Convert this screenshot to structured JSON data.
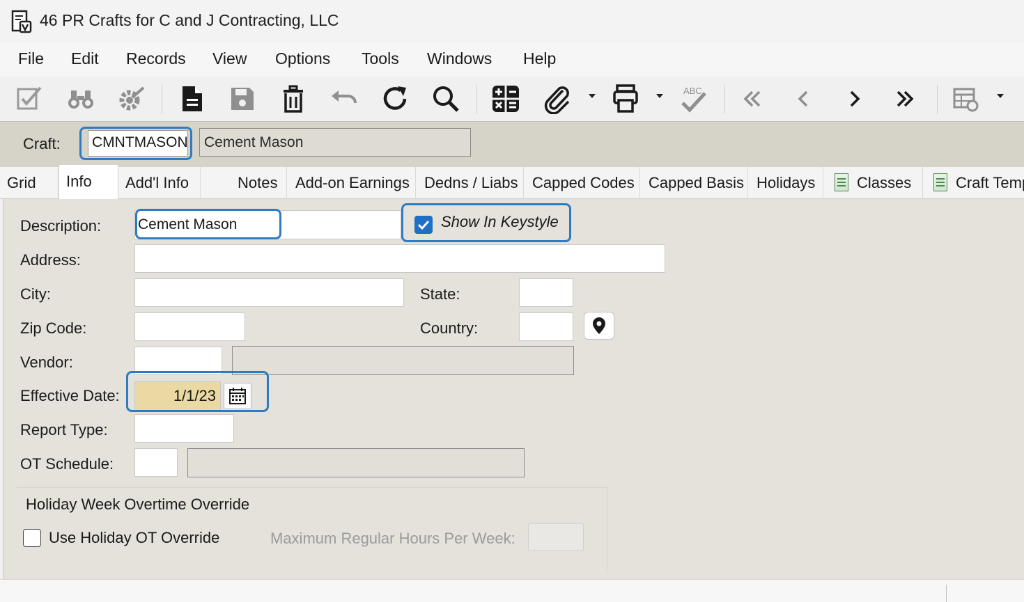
{
  "window": {
    "title": "46 PR Crafts for C and J Contracting, LLC"
  },
  "menu": {
    "file": "File",
    "edit": "Edit",
    "records": "Records",
    "view": "View",
    "options": "Options",
    "tools": "Tools",
    "windows": "Windows",
    "help": "Help"
  },
  "toolbar": {
    "icons": [
      "edit-icon",
      "binoculars-icon",
      "settings-gear-icon",
      "new-record-icon",
      "save-icon",
      "delete-icon",
      "undo-icon",
      "refresh-icon",
      "search-icon",
      "calculator-icon",
      "attachment-icon",
      "print-icon",
      "spellcheck-icon",
      "first-record-icon",
      "previous-record-icon",
      "next-record-icon",
      "last-record-icon",
      "grid-settings-icon"
    ],
    "spellcheck_text": "ABC"
  },
  "craft": {
    "label": "Craft:",
    "code": "CMNTMASON",
    "description": "Cement Mason"
  },
  "tabs": {
    "grid": "Grid",
    "info": "Info",
    "addl_info": "Add'l Info",
    "notes": "Notes",
    "addon_earnings": "Add-on Earnings",
    "dedns_liabs": "Dedns / Liabs",
    "capped_codes": "Capped Codes",
    "capped_basis": "Capped Basis",
    "holidays": "Holidays",
    "classes": "Classes",
    "craft_template": "Craft Template",
    "active": "Info"
  },
  "form": {
    "description_label": "Description:",
    "description_value": "Cement Mason",
    "show_in_keystyle_label": "Show In Keystyle",
    "show_in_keystyle_checked": true,
    "address_label": "Address:",
    "address_value": "",
    "city_label": "City:",
    "city_value": "",
    "state_label": "State:",
    "state_value": "",
    "zip_label": "Zip Code:",
    "zip_value": "",
    "country_label": "Country:",
    "country_value": "",
    "vendor_label": "Vendor:",
    "vendor_value": "",
    "vendor_name": "",
    "effective_date_label": "Effective Date:",
    "effective_date_value": "1/1/23",
    "report_type_label": "Report Type:",
    "report_type_value": "",
    "ot_schedule_label": "OT Schedule:",
    "ot_schedule_value": "",
    "ot_schedule_desc": ""
  },
  "holiday": {
    "group_title": "Holiday Week Overtime Override",
    "use_override_label": "Use Holiday OT Override",
    "use_override_checked": false,
    "max_hours_label": "Maximum Regular Hours Per Week:",
    "max_hours_value": ""
  },
  "colors": {
    "accent": "#2f7bc2",
    "panel": "#e4e2db",
    "craft_strip": "#d6d3c9",
    "date_highlight": "#ead9a3"
  }
}
